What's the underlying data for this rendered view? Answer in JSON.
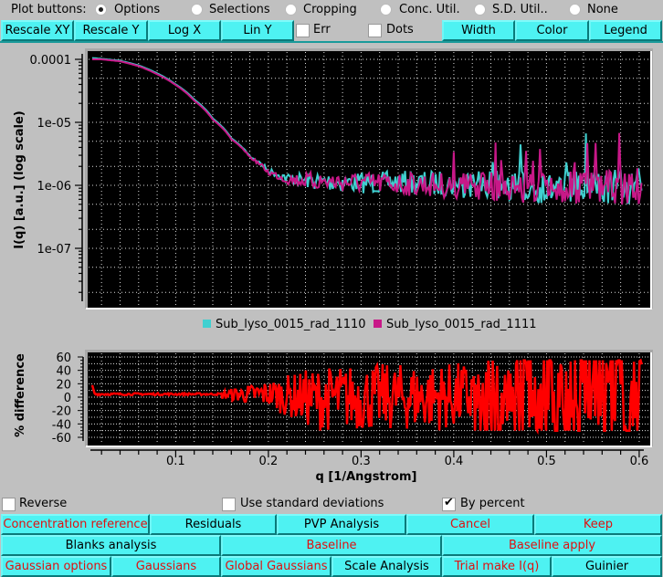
{
  "plot_buttons": {
    "label": "Plot buttons:",
    "options": [
      {
        "label": "Options",
        "selected": true
      },
      {
        "label": "Selections",
        "selected": false
      },
      {
        "label": "Cropping",
        "selected": false
      },
      {
        "label": "Conc. Util.",
        "selected": false
      },
      {
        "label": "S.D. Util..",
        "selected": false
      },
      {
        "label": "None",
        "selected": false
      }
    ]
  },
  "toolbar": {
    "buttons": [
      "Rescale XY",
      "Rescale Y",
      "Log X",
      "Lin Y",
      "Width",
      "Color",
      "Legend"
    ],
    "checkboxes": [
      {
        "label": "Err",
        "checked": false
      },
      {
        "label": "Dots",
        "checked": false
      }
    ]
  },
  "colors": {
    "series1": "#40d0d0",
    "series2": "#c81888",
    "diff": "#ff0000",
    "button_bg": "#4ef2f2",
    "red_text": "#e01010"
  },
  "chart_data": [
    {
      "type": "line",
      "title": "",
      "xlabel": "",
      "ylabel": "I(q) [a.u.] (log scale)",
      "yscale": "log",
      "ylim": [
        2e-08,
        0.00013
      ],
      "xlim": [
        0.008,
        0.605
      ],
      "y_ticks": [
        "0.0001",
        "1e-05",
        "1e-06",
        "1e-07"
      ],
      "y_tick_values": [
        0.0001,
        1e-05,
        1e-06,
        1e-07
      ],
      "grid": true,
      "legend": "bottom",
      "series": [
        {
          "name": "Sub_lyso_0015_rad_1110",
          "x": [
            0.01,
            0.02,
            0.04,
            0.06,
            0.08,
            0.1,
            0.12,
            0.14,
            0.16,
            0.18,
            0.2,
            0.22,
            0.24,
            0.26,
            0.3,
            0.35,
            0.4,
            0.45,
            0.5,
            0.55,
            0.6
          ],
          "y": [
            0.000105,
            0.000102,
            9.5e-05,
            8e-05,
            6e-05,
            4e-05,
            2.3e-05,
            1.15e-05,
            5.6e-06,
            2.9e-06,
            1.7e-06,
            1.3e-06,
            1.2e-06,
            1.15e-06,
            1.1e-06,
            1.1e-06,
            1.05e-06,
            1e-06,
            9e-07,
            9e-07,
            1e-06
          ]
        },
        {
          "name": "Sub_lyso_0015_rad_1111",
          "x": [
            0.01,
            0.02,
            0.04,
            0.06,
            0.08,
            0.1,
            0.12,
            0.14,
            0.16,
            0.18,
            0.2,
            0.22,
            0.24,
            0.26,
            0.3,
            0.35,
            0.4,
            0.45,
            0.5,
            0.55,
            0.6
          ],
          "y": [
            0.0001,
            0.0001,
            9.3e-05,
            7.8e-05,
            5.8e-05,
            3.9e-05,
            2.2e-05,
            1.1e-05,
            5.4e-06,
            2.8e-06,
            1.6e-06,
            1.25e-06,
            1.2e-06,
            1.15e-06,
            1.1e-06,
            1.05e-06,
            1e-06,
            9.5e-07,
            9e-07,
            9e-07,
            9.5e-07
          ]
        }
      ]
    },
    {
      "type": "line",
      "title": "",
      "xlabel": "q [1/Angstrom]",
      "ylabel": "% difference",
      "ylim": [
        -65,
        65
      ],
      "xlim": [
        0.008,
        0.605
      ],
      "y_ticks": [
        "60",
        "40",
        "20",
        "0",
        "-20",
        "-40",
        "-60"
      ],
      "y_tick_values": [
        60,
        40,
        20,
        0,
        -20,
        -40,
        -60
      ],
      "x_ticks": [
        "0.1",
        "0.2",
        "0.3",
        "0.4",
        "0.5",
        "0.6"
      ],
      "x_tick_values": [
        0.1,
        0.2,
        0.3,
        0.4,
        0.5,
        0.6
      ],
      "grid": true,
      "series": [
        {
          "name": "% difference",
          "x": [
            0.01,
            0.1,
            0.15,
            0.2,
            0.25,
            0.3,
            0.35,
            0.4,
            0.45,
            0.5,
            0.55,
            0.6
          ],
          "y_range": [
            [
              0,
              18
            ],
            [
              2,
              6
            ],
            [
              -3,
              10
            ],
            [
              -15,
              25
            ],
            [
              -50,
              45
            ],
            [
              -50,
              50
            ],
            [
              -50,
              50
            ],
            [
              -50,
              52
            ],
            [
              -50,
              55
            ],
            [
              -50,
              55
            ],
            [
              -50,
              55
            ],
            [
              -50,
              55
            ]
          ]
        }
      ]
    }
  ],
  "options": {
    "checkboxes": [
      {
        "label": "Reverse",
        "checked": false
      },
      {
        "label": "Use standard deviations",
        "checked": false
      },
      {
        "label": "By percent",
        "checked": true
      }
    ]
  },
  "bottom_buttons": {
    "row1": [
      {
        "label": "Concentration reference",
        "red": true
      },
      {
        "label": "Residuals",
        "red": false
      },
      {
        "label": "PVP Analysis",
        "red": false
      },
      {
        "label": "Cancel",
        "red": true
      },
      {
        "label": "Keep",
        "red": true
      }
    ],
    "row2": [
      {
        "label": "Blanks analysis",
        "red": false
      },
      {
        "label": "Baseline",
        "red": true
      },
      {
        "label": "Baseline apply",
        "red": true
      }
    ],
    "row3": [
      {
        "label": "Gaussian options",
        "red": true
      },
      {
        "label": "Gaussians",
        "red": true
      },
      {
        "label": "Global Gaussians",
        "red": true
      },
      {
        "label": "Scale Analysis",
        "red": false
      },
      {
        "label": "Trial make I(q)",
        "red": true
      },
      {
        "label": "Guinier",
        "red": false
      }
    ]
  }
}
